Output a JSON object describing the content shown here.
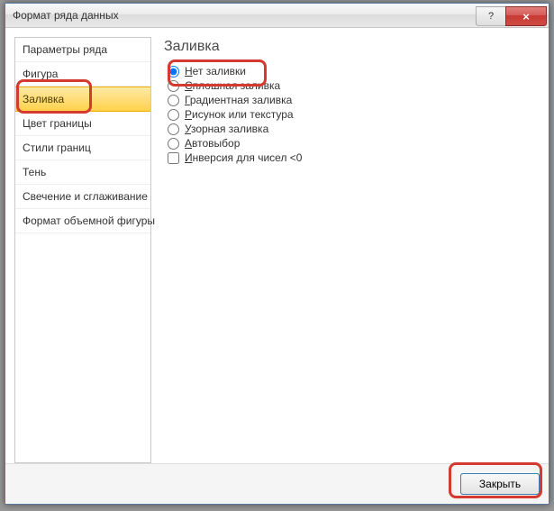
{
  "window": {
    "title": "Формат ряда данных",
    "help_label": "?",
    "close_x_label": "×"
  },
  "sidebar": {
    "items": [
      {
        "label": "Параметры ряда",
        "selected": false
      },
      {
        "label": "Фигура",
        "selected": false
      },
      {
        "label": "Заливка",
        "selected": true
      },
      {
        "label": "Цвет границы",
        "selected": false
      },
      {
        "label": "Стили границ",
        "selected": false
      },
      {
        "label": "Тень",
        "selected": false
      },
      {
        "label": "Свечение и сглаживание",
        "selected": false
      },
      {
        "label": "Формат объемной фигуры",
        "selected": false
      }
    ]
  },
  "panel": {
    "heading": "Заливка",
    "options": [
      {
        "type": "radio",
        "label": "Нет заливки",
        "u": "Н",
        "checked": true
      },
      {
        "type": "radio",
        "label": "Сплошная заливка",
        "u": "С",
        "checked": false
      },
      {
        "type": "radio",
        "label": "Градиентная заливка",
        "u": "Г",
        "checked": false
      },
      {
        "type": "radio",
        "label": "Рисунок или текстура",
        "u": "Р",
        "checked": false
      },
      {
        "type": "radio",
        "label": "Узорная заливка",
        "u": "У",
        "checked": false
      },
      {
        "type": "radio",
        "label": "Автовыбор",
        "u": "А",
        "checked": false
      },
      {
        "type": "checkbox",
        "label": "Инверсия для чисел <0",
        "u": "И",
        "checked": false
      }
    ]
  },
  "footer": {
    "close_label": "Закрыть"
  },
  "highlights": {
    "sidebar_item_index": 2,
    "option_index": 0,
    "close_button": true
  }
}
